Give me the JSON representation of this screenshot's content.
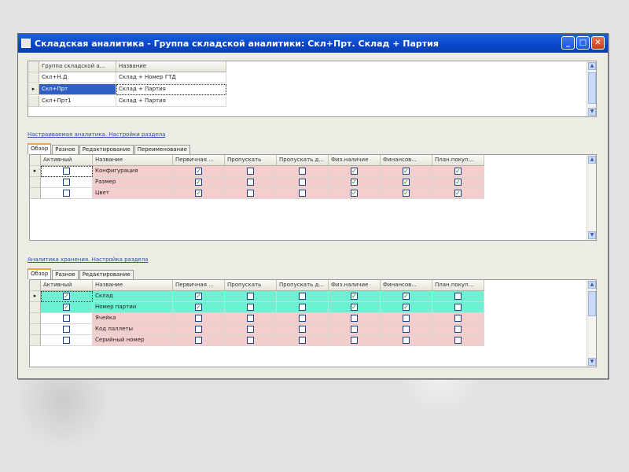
{
  "window": {
    "title": "Складская аналитика - Группа складской аналитики: Скл+Прт. Склад + Партия"
  },
  "groups_grid": {
    "headers": [
      "Группа складской а...",
      "Название"
    ],
    "rows": [
      {
        "code": "Скл+Н.Д",
        "name": "Склад + Номер ГТД",
        "selected": false
      },
      {
        "code": "Скл+Прт",
        "name": "Склад + Партия",
        "selected": true
      },
      {
        "code": "Скл+Прт1",
        "name": "Склад + Партия",
        "selected": false
      }
    ]
  },
  "section1": {
    "label": "Настраиваемая аналитика. Настройки раздела",
    "tabs": [
      "Обзор",
      "Разное",
      "Редактирование",
      "Переименование"
    ],
    "active_tab": 0,
    "headers": [
      "Активный",
      "Название",
      "Первичная ...",
      "Пропускать",
      "Пропускать д...",
      "Физ.наличие",
      "Финансов...",
      "План.покуп..."
    ],
    "rows": [
      {
        "active": false,
        "name": "Конфигурация",
        "checks": [
          true,
          false,
          false,
          true,
          true,
          true
        ]
      },
      {
        "active": false,
        "name": "Размер",
        "checks": [
          true,
          false,
          false,
          true,
          true,
          true
        ]
      },
      {
        "active": false,
        "name": "Цвет",
        "checks": [
          true,
          false,
          false,
          true,
          true,
          true
        ]
      }
    ]
  },
  "section2": {
    "label": "Аналитика хранения. Настройка раздела",
    "tabs": [
      "Обзор",
      "Разное",
      "Редактирование"
    ],
    "active_tab": 0,
    "headers": [
      "Активный",
      "Название",
      "Первичная ...",
      "Пропускать",
      "Пропускать д...",
      "Физ.наличие",
      "Финансов...",
      "План.покуп..."
    ],
    "rows": [
      {
        "active": true,
        "name": "Склад",
        "highlight": true,
        "checks": [
          true,
          false,
          false,
          true,
          true,
          false
        ]
      },
      {
        "active": true,
        "name": "Номер партии",
        "highlight": true,
        "checks": [
          true,
          false,
          false,
          true,
          true,
          false
        ]
      },
      {
        "active": false,
        "name": "Ячейка",
        "highlight": false,
        "checks": [
          false,
          false,
          false,
          false,
          false,
          false
        ]
      },
      {
        "active": false,
        "name": "Код паллеты",
        "highlight": false,
        "checks": [
          false,
          false,
          false,
          false,
          false,
          false
        ]
      },
      {
        "active": false,
        "name": "Серийный номер",
        "highlight": false,
        "checks": [
          false,
          false,
          false,
          false,
          false,
          false
        ]
      }
    ]
  },
  "colors": {
    "titlebar": "#0a45c8",
    "row_pink": "#f6cdcd",
    "row_green": "#6ef0d2",
    "selection": "#2f5fc4",
    "check_green": "#1a7a1a"
  }
}
